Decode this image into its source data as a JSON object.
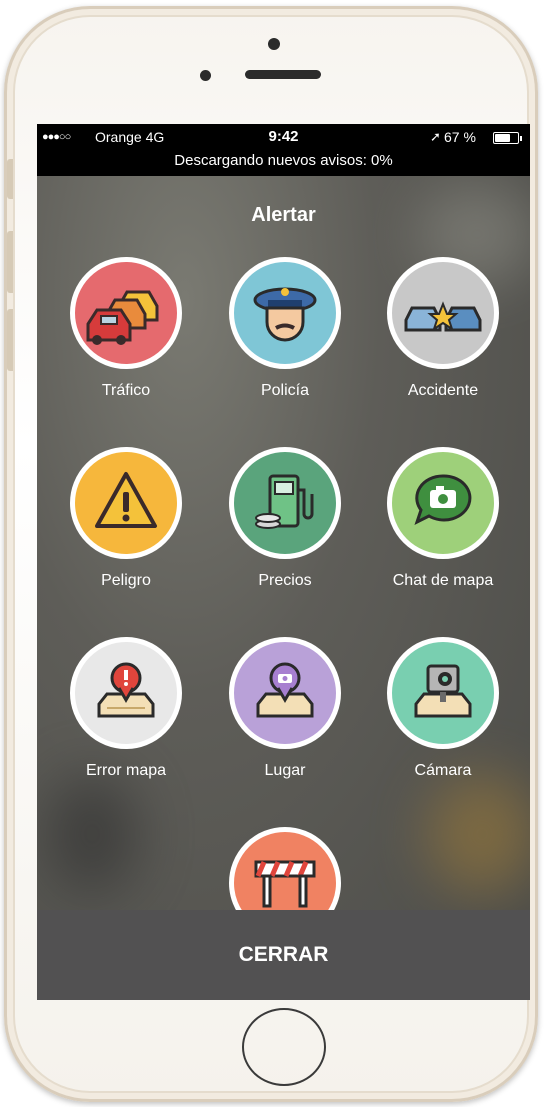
{
  "status_bar": {
    "signal": "●●●○○",
    "carrier": "Orange  4G",
    "time": "9:42",
    "location_icon": "location-arrow-icon",
    "battery_text": "67 %",
    "battery_level": 0.67
  },
  "banner": {
    "download_message": "Descargando nuevos avisos: 0%"
  },
  "header": {
    "title": "Alertar"
  },
  "alerts": [
    {
      "label": "Tráfico",
      "icon": "traffic-cars-icon",
      "color": "#e56a6e"
    },
    {
      "label": "Policía",
      "icon": "police-icon",
      "color": "#7fc6d6"
    },
    {
      "label": "Accidente",
      "icon": "accident-icon",
      "color": "#c8c8c8"
    },
    {
      "label": "Peligro",
      "icon": "hazard-icon",
      "color": "#f6b73c"
    },
    {
      "label": "Precios",
      "icon": "gas-price-icon",
      "color": "#5aa47c"
    },
    {
      "label": "Chat de mapa",
      "icon": "map-chat-icon",
      "color": "#9ed07a"
    },
    {
      "label": "Error mapa",
      "icon": "map-error-icon",
      "color": "#e8e8e8"
    },
    {
      "label": "Lugar",
      "icon": "place-icon",
      "color": "#b9a1d8"
    },
    {
      "label": "Cámara",
      "icon": "camera-icon",
      "color": "#79cfb0"
    },
    {
      "label": "",
      "icon": "road-closure-icon",
      "color": "#f08262"
    }
  ],
  "footer": {
    "close_label": "CERRAR"
  }
}
